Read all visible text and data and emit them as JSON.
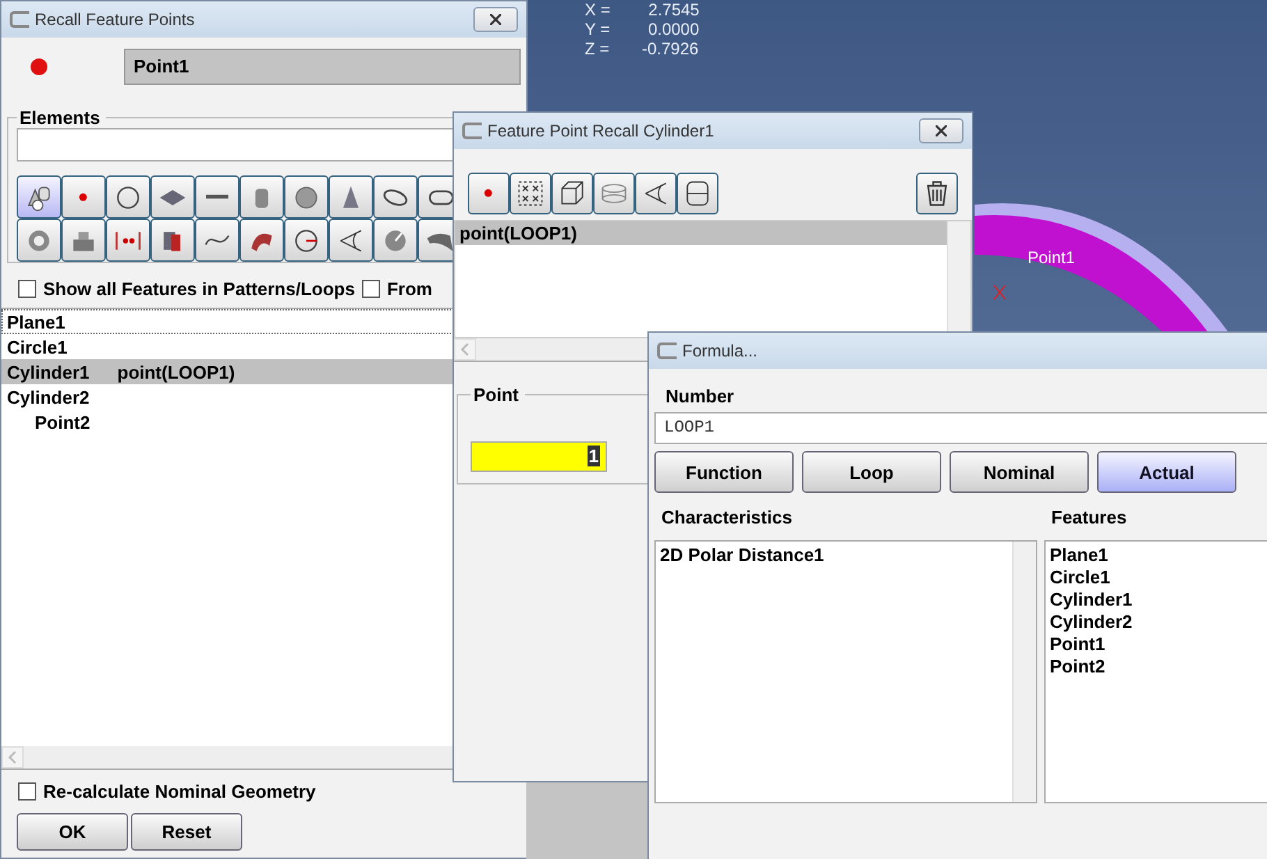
{
  "viewport": {
    "coordinates": [
      {
        "axis": "X =",
        "value": "2.7545"
      },
      {
        "axis": "Y =",
        "value": "0.0000"
      },
      {
        "axis": "Z =",
        "value": "-0.7926"
      }
    ],
    "point_label": "Point1"
  },
  "recall_window": {
    "title": "Recall Feature Points",
    "name_value": "Point1",
    "elements_label": "Elements",
    "element_tools": [
      {
        "kind": "multi",
        "selected": true
      },
      {
        "kind": "point",
        "selected": false
      },
      {
        "kind": "circle",
        "selected": false
      },
      {
        "kind": "plane",
        "selected": false
      },
      {
        "kind": "line",
        "selected": false
      },
      {
        "kind": "cylinder",
        "selected": false
      },
      {
        "kind": "sphere",
        "selected": false
      },
      {
        "kind": "cone",
        "selected": false
      },
      {
        "kind": "ellipse",
        "selected": false
      },
      {
        "kind": "slot",
        "selected": false
      },
      {
        "kind": "torus",
        "selected": false
      },
      {
        "kind": "step",
        "selected": false
      },
      {
        "kind": "distance",
        "selected": false
      },
      {
        "kind": "pair",
        "selected": false
      },
      {
        "kind": "curve",
        "selected": false
      },
      {
        "kind": "freeform",
        "selected": false
      },
      {
        "kind": "clock",
        "selected": false
      },
      {
        "kind": "angle",
        "selected": false
      },
      {
        "kind": "gauge",
        "selected": false
      },
      {
        "kind": "surface",
        "selected": false
      }
    ],
    "show_all_checkbox": {
      "label": "Show all Features in Patterns/Loops",
      "checked": false
    },
    "from_checkbox": {
      "label": "From",
      "checked": false
    },
    "features": [
      {
        "name": "Plane1",
        "selected": false,
        "focused": true
      },
      {
        "name": "Circle1",
        "selected": false,
        "focused": false
      },
      {
        "name": "Cylinder1",
        "detail": "point(LOOP1)",
        "selected": true,
        "focused": false
      },
      {
        "name": "Cylinder2",
        "selected": false,
        "focused": false,
        "children": [
          {
            "name": "Point2",
            "selected": false,
            "focused": false
          }
        ]
      }
    ],
    "recalc_checkbox": {
      "label": "Re-calculate Nominal Geometry",
      "checked": false
    },
    "buttons": [
      "OK",
      "Reset"
    ]
  },
  "recall_cylinder_window": {
    "title": "Feature Point Recall Cylinder1",
    "tools": [
      {
        "kind": "point"
      },
      {
        "kind": "grid"
      },
      {
        "kind": "cube"
      },
      {
        "kind": "disc"
      },
      {
        "kind": "angle"
      },
      {
        "kind": "diameter"
      }
    ],
    "points": [
      {
        "label": "point(LOOP1)",
        "selected": true
      }
    ],
    "point_group": {
      "label": "Point",
      "value": "1"
    }
  },
  "formula_window": {
    "title": "Formula...",
    "number_label": "Number",
    "number_value": "LOOP1",
    "buttons": [
      {
        "label": "Function",
        "selected": false
      },
      {
        "label": "Loop",
        "selected": false
      },
      {
        "label": "Nominal",
        "selected": false
      },
      {
        "label": "Actual",
        "selected": true
      }
    ],
    "characteristics_label": "Characteristics",
    "characteristics": [
      "2D Polar Distance1"
    ],
    "features_label": "Features",
    "features": [
      "Plane1",
      "Circle1",
      "Cylinder1",
      "Cylinder2",
      "Point1",
      "Point2"
    ]
  }
}
